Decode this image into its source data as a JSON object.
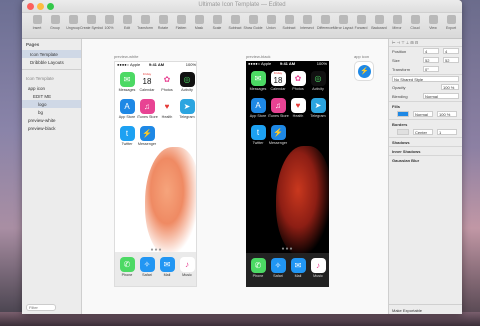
{
  "window": {
    "title": "Ultimate Icon Template — Edited"
  },
  "toolbar": {
    "items": [
      {
        "label": "Insert",
        "icon": "plus-icon"
      },
      {
        "label": "Group",
        "icon": "group-icon"
      },
      {
        "label": "Ungroup",
        "icon": "ungroup-icon"
      },
      {
        "label": "Create Symbol",
        "icon": "symbol-icon"
      },
      {
        "label": "100%",
        "icon": "zoom-icon"
      },
      {
        "label": "Edit",
        "icon": "edit-icon"
      },
      {
        "label": "Transform",
        "icon": "transform-icon"
      },
      {
        "label": "Rotate",
        "icon": "rotate-icon"
      },
      {
        "label": "Flatten",
        "icon": "flatten-icon"
      },
      {
        "label": "Mask",
        "icon": "mask-icon"
      },
      {
        "label": "Scale",
        "icon": "scale-icon"
      },
      {
        "label": "Subtract",
        "icon": "subtract-icon"
      },
      {
        "label": "Show Guide",
        "icon": "guide-icon"
      },
      {
        "label": "Union",
        "icon": "union-icon"
      },
      {
        "label": "Subtract",
        "icon": "subtract-icon"
      },
      {
        "label": "Intersect",
        "icon": "intersect-icon"
      },
      {
        "label": "Difference",
        "icon": "difference-icon"
      },
      {
        "label": "Mirror Layout",
        "icon": "mirror-icon"
      },
      {
        "label": "Forward",
        "icon": "forward-icon"
      },
      {
        "label": "Backward",
        "icon": "backward-icon"
      },
      {
        "label": "Mirror",
        "icon": "preview-icon"
      },
      {
        "label": "Cloud",
        "icon": "cloud-icon"
      },
      {
        "label": "View",
        "icon": "view-icon"
      },
      {
        "label": "Export",
        "icon": "export-icon"
      }
    ]
  },
  "sidebar": {
    "pages_header": "Pages",
    "pages": [
      "Icon Template",
      "Dribbble Layouts"
    ],
    "layers_header": "Icon Template",
    "layers": [
      "app icon",
      "EDIT ME",
      "logo",
      "bg",
      "preview-white",
      "preview-black"
    ],
    "filter_placeholder": "Filter"
  },
  "canvas": {
    "artboard_white": "preview-white",
    "artboard_black": "preview-black",
    "artboard_icon": "app icon"
  },
  "phone": {
    "carrier": "●●●●○ Apple",
    "time": "9:41 AM",
    "battery": "100%",
    "calendar_day": "Friday",
    "calendar_date": "18",
    "page_dots": "●●●",
    "apps": [
      {
        "name": "Messages",
        "icon": "messages-icon",
        "color": "#4cd964"
      },
      {
        "name": "Calendar",
        "icon": "calendar-icon",
        "color": "#ffffff"
      },
      {
        "name": "Photos",
        "icon": "photos-icon",
        "color": "#ffffff"
      },
      {
        "name": "Activity",
        "icon": "activity-icon",
        "color": "#111111"
      },
      {
        "name": "App Store",
        "icon": "appstore-icon",
        "color": "#1e88e5"
      },
      {
        "name": "iTunes Store",
        "icon": "itunes-icon",
        "color": "#e84393"
      },
      {
        "name": "Health",
        "icon": "health-icon",
        "color": "#ffffff"
      },
      {
        "name": "Telegram",
        "icon": "telegram-icon",
        "color": "#2ca5e0"
      },
      {
        "name": "Twitter",
        "icon": "twitter-icon",
        "color": "#1da1f2"
      },
      {
        "name": "Messenger",
        "icon": "messenger-icon",
        "color": "#1e88e5"
      }
    ],
    "dock": [
      {
        "name": "Phone",
        "icon": "phone-icon",
        "color": "#4cd964"
      },
      {
        "name": "Safari",
        "icon": "safari-icon",
        "color": "#2196f3"
      },
      {
        "name": "Mail",
        "icon": "mail-icon",
        "color": "#2196f3"
      },
      {
        "name": "Music",
        "icon": "music-icon",
        "color": "#ffffff"
      }
    ]
  },
  "inspector": {
    "position_label": "Position",
    "pos_x": "4",
    "pos_y": "4",
    "size_label": "Size",
    "width": "52",
    "height": "52",
    "transform_label": "Transform",
    "rotate": "0°",
    "shared_style": "No Shared Style",
    "opacity_label": "Opacity",
    "opacity": "100 %",
    "blending_label": "Blending",
    "blending": "Normal",
    "fills_label": "Fills",
    "fill_blend": "Normal",
    "fill_opacity": "100 %",
    "borders_label": "Borders",
    "border_pos": "Center",
    "border_thickness": "1",
    "shadows_label": "Shadows",
    "inner_shadows_label": "Inner Shadows",
    "blur_label": "Gaussian Blur",
    "export_label": "Make Exportable"
  },
  "colors": {
    "accent": "#1e88e5",
    "selection": "#cfd8e6"
  }
}
